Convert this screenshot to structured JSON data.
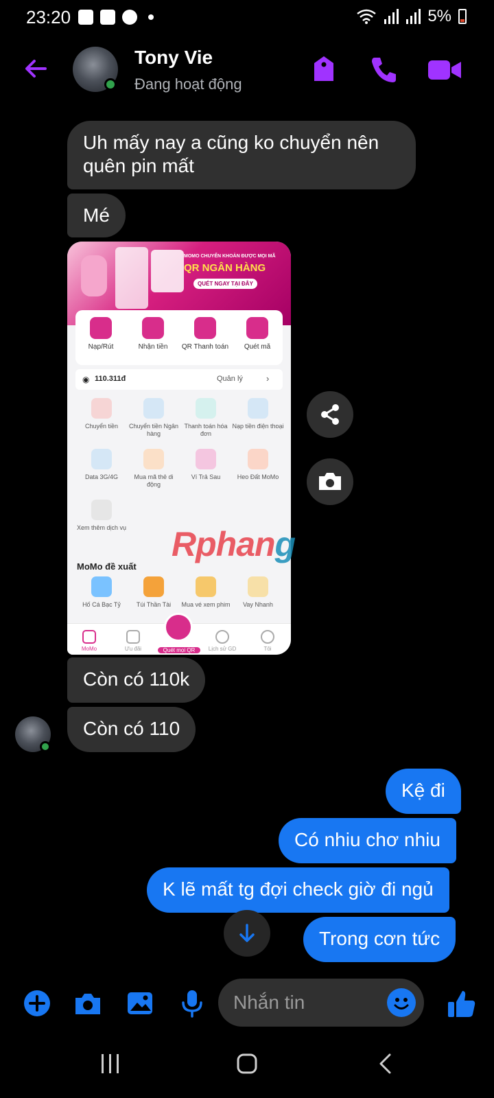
{
  "status_bar": {
    "time": "23:20",
    "battery": "5%",
    "left_icons": [
      "gallery-icon",
      "alert-icon",
      "telegram-icon"
    ],
    "right_icons": [
      "wifi-icon",
      "signal-icon",
      "signal-icon",
      "battery-icon"
    ]
  },
  "header": {
    "contact_name": "Tony Vie",
    "presence": "Đang hoạt động",
    "online": true,
    "actions": [
      "tag-icon",
      "phone-icon",
      "video-icon"
    ]
  },
  "messages": [
    {
      "side": "in",
      "text": "Uh mấy nay a cũng ko chuyển nên quên pin mất"
    },
    {
      "side": "in",
      "text": "Mé"
    },
    {
      "side": "in",
      "type": "image"
    },
    {
      "side": "in",
      "text": "Còn có 110k"
    },
    {
      "side": "in",
      "text": "Còn có 110"
    },
    {
      "side": "out",
      "text": "Kệ đi"
    },
    {
      "side": "out",
      "text": "Có nhiu chơ nhiu"
    },
    {
      "side": "out",
      "text": "K lẽ mất tg đợi check giờ đi ngủ"
    },
    {
      "side": "out",
      "text": "Trong cơn tức"
    }
  ],
  "momo": {
    "banner_line1": "MOMO CHUYỂN KHOẢN ĐƯỢC MỌI MÃ",
    "banner_line2": "QR NGÂN HÀNG",
    "banner_cta": "QUÉT NGAY TẠI ĐÂY",
    "quick_actions": [
      "Nạp/Rút",
      "Nhận tiền",
      "QR Thanh toán",
      "Quét mã"
    ],
    "balance": "110.311đ",
    "manage": "Quản lý",
    "services": [
      "Chuyển tiền",
      "Chuyển tiền Ngân hàng",
      "Thanh toán hóa đơn",
      "Nạp tiền điện thoại",
      "Data 3G/4G",
      "Mua mã thẻ di động",
      "Ví Trả Sau",
      "Heo Đất MoMo",
      "Xem thêm dịch vụ"
    ],
    "suggest_title": "MoMo đề xuất",
    "suggestions": [
      "Hố Cá Bạc Tỷ",
      "Túi Thần Tài",
      "Mua vé xem phim",
      "Vay Nhanh"
    ],
    "tabs": [
      "MoMo",
      "Ưu đãi",
      "Quét mọi QR",
      "Lịch sử GD",
      "Tôi"
    ],
    "watermark_a": "Rphan",
    "watermark_b": "g"
  },
  "composer": {
    "placeholder": "Nhắn tin",
    "icons": [
      "plus-icon",
      "camera-icon",
      "gallery-icon",
      "mic-icon",
      "emoji-icon",
      "like-icon"
    ]
  },
  "colors": {
    "accent_purple": "#a033ff",
    "outgoing_blue": "#1877f2",
    "incoming_gray": "#303030",
    "online_green": "#31a24c",
    "momo_pink": "#d82d8b"
  }
}
